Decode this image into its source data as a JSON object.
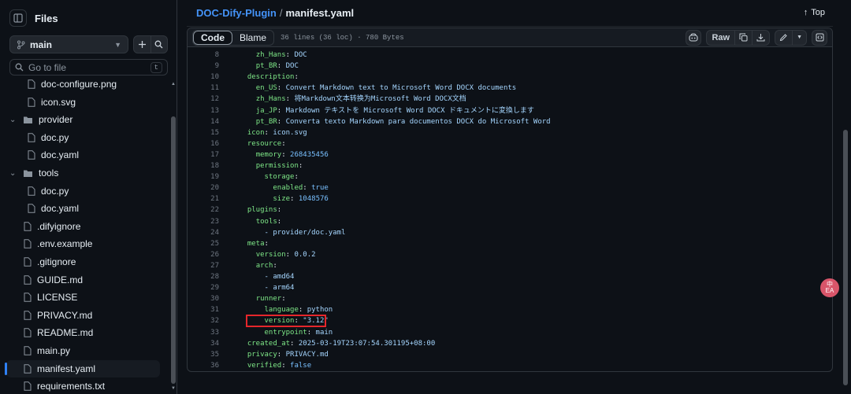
{
  "sidebar": {
    "title": "Files",
    "branch": "main",
    "search_placeholder": "Go to file",
    "search_shortcut": "t",
    "items": [
      {
        "label": "doc-configure.png",
        "type": "file",
        "depth": 2
      },
      {
        "label": "icon.svg",
        "type": "file",
        "depth": 2
      },
      {
        "label": "provider",
        "type": "folder",
        "depth": 1
      },
      {
        "label": "doc.py",
        "type": "file",
        "depth": 2
      },
      {
        "label": "doc.yaml",
        "type": "file",
        "depth": 2
      },
      {
        "label": "tools",
        "type": "folder",
        "depth": 1
      },
      {
        "label": "doc.py",
        "type": "file",
        "depth": 2
      },
      {
        "label": "doc.yaml",
        "type": "file",
        "depth": 2
      },
      {
        "label": ".difyignore",
        "type": "file",
        "depth": 1
      },
      {
        "label": ".env.example",
        "type": "file",
        "depth": 1
      },
      {
        "label": ".gitignore",
        "type": "file",
        "depth": 1
      },
      {
        "label": "GUIDE.md",
        "type": "file",
        "depth": 1
      },
      {
        "label": "LICENSE",
        "type": "file",
        "depth": 1
      },
      {
        "label": "PRIVACY.md",
        "type": "file",
        "depth": 1
      },
      {
        "label": "README.md",
        "type": "file",
        "depth": 1
      },
      {
        "label": "main.py",
        "type": "file",
        "depth": 1
      },
      {
        "label": "manifest.yaml",
        "type": "file",
        "depth": 1,
        "selected": true
      },
      {
        "label": "requirements.txt",
        "type": "file",
        "depth": 1
      }
    ]
  },
  "breadcrumb": {
    "repo": "DOC-Dify-Plugin",
    "separator": "/",
    "file": "manifest.yaml"
  },
  "top_link": "Top",
  "file_header": {
    "code_tab": "Code",
    "blame_tab": "Blame",
    "meta": "36 lines (36 loc) · 780 Bytes",
    "raw_label": "Raw"
  },
  "code_lines": [
    {
      "n": "8",
      "indent": "    ",
      "key": "zh_Hans",
      "val": "DOC",
      "vt": "v"
    },
    {
      "n": "9",
      "indent": "    ",
      "key": "pt_BR",
      "val": "DOC",
      "vt": "v"
    },
    {
      "n": "10",
      "indent": "  ",
      "key": "description",
      "val": "",
      "vt": "v"
    },
    {
      "n": "11",
      "indent": "    ",
      "key": "en_US",
      "val": "Convert Markdown text to Microsoft Word DOCX documents",
      "vt": "v"
    },
    {
      "n": "12",
      "indent": "    ",
      "key": "zh_Hans",
      "val": "将Markdown文本转换为Microsoft Word DOCX文档",
      "vt": "v"
    },
    {
      "n": "13",
      "indent": "    ",
      "key": "ja_JP",
      "val": "Markdown テキストを Microsoft Word DOCX ドキュメントに変換します",
      "vt": "v"
    },
    {
      "n": "14",
      "indent": "    ",
      "key": "pt_BR",
      "val": "Converta texto Markdown para documentos DOCX do Microsoft Word",
      "vt": "v"
    },
    {
      "n": "15",
      "indent": "  ",
      "key": "icon",
      "val": "icon.svg",
      "vt": "v"
    },
    {
      "n": "16",
      "indent": "  ",
      "key": "resource",
      "val": "",
      "vt": "v"
    },
    {
      "n": "17",
      "indent": "    ",
      "key": "memory",
      "val": "268435456",
      "vt": "n"
    },
    {
      "n": "18",
      "indent": "    ",
      "key": "permission",
      "val": "",
      "vt": "v"
    },
    {
      "n": "19",
      "indent": "      ",
      "key": "storage",
      "val": "",
      "vt": "v"
    },
    {
      "n": "20",
      "indent": "        ",
      "key": "enabled",
      "val": "true",
      "vt": "n"
    },
    {
      "n": "21",
      "indent": "        ",
      "key": "size",
      "val": "1048576",
      "vt": "n"
    },
    {
      "n": "22",
      "indent": "  ",
      "key": "plugins",
      "val": "",
      "vt": "v"
    },
    {
      "n": "23",
      "indent": "    ",
      "key": "tools",
      "val": "",
      "vt": "v"
    },
    {
      "n": "24",
      "indent": "      ",
      "key": "",
      "val": "- provider/doc.yaml",
      "vt": "v"
    },
    {
      "n": "25",
      "indent": "  ",
      "key": "meta",
      "val": "",
      "vt": "v"
    },
    {
      "n": "26",
      "indent": "    ",
      "key": "version",
      "val": "0.0.2",
      "vt": "v"
    },
    {
      "n": "27",
      "indent": "    ",
      "key": "arch",
      "val": "",
      "vt": "v"
    },
    {
      "n": "28",
      "indent": "      ",
      "key": "",
      "val": "- amd64",
      "vt": "v"
    },
    {
      "n": "29",
      "indent": "      ",
      "key": "",
      "val": "- arm64",
      "vt": "v"
    },
    {
      "n": "30",
      "indent": "    ",
      "key": "runner",
      "val": "",
      "vt": "v"
    },
    {
      "n": "31",
      "indent": "      ",
      "key": "language",
      "val": "python",
      "vt": "v"
    },
    {
      "n": "32",
      "indent": "      ",
      "key": "version",
      "val": "\"3.12\"",
      "vt": "v",
      "highlight": true
    },
    {
      "n": "33",
      "indent": "      ",
      "key": "entrypoint",
      "val": "main",
      "vt": "v"
    },
    {
      "n": "34",
      "indent": "  ",
      "key": "created_at",
      "val": "2025-03-19T23:07:54.301195+08:00",
      "vt": "v"
    },
    {
      "n": "35",
      "indent": "  ",
      "key": "privacy",
      "val": "PRIVACY.md",
      "vt": "v"
    },
    {
      "n": "36",
      "indent": "  ",
      "key": "verified",
      "val": "false",
      "vt": "n"
    }
  ],
  "colors": {
    "background": "#0d1117",
    "link": "#4493f8",
    "yaml_key": "#7ee787",
    "yaml_value": "#a5d6ff",
    "highlight_box": "#e5262b"
  },
  "translate_badge": "中\nEA"
}
